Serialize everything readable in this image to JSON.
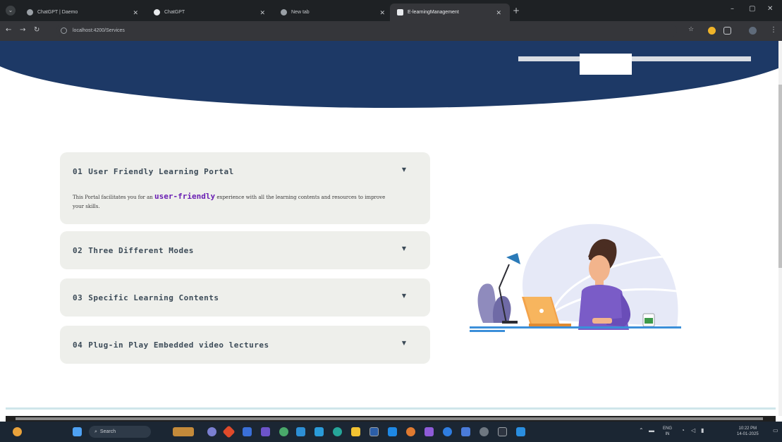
{
  "browser": {
    "tabs": [
      {
        "label": "ChatGPT | Daemo"
      },
      {
        "label": "ChatGPT"
      },
      {
        "label": "New tab"
      },
      {
        "label": "E-learningManagement"
      }
    ],
    "new_tab": "+",
    "minimize": "–",
    "maximize": "▢",
    "close": "✕",
    "url": "localhost:4200/Services"
  },
  "features": [
    {
      "num": "01",
      "title": "User Friendly Learning Portal",
      "expanded": true,
      "body_pre": "This Portal facilitates you for an ",
      "body_highlight": "user-friendly",
      "body_post": " experience with all the learning contents and resources to improve your skills."
    },
    {
      "num": "02",
      "title": "Three Different Modes",
      "expanded": false
    },
    {
      "num": "03",
      "title": "Specific Learning Contents",
      "expanded": false
    },
    {
      "num": "04",
      "title": "Plug-in Play Embedded video lectures",
      "expanded": false
    }
  ],
  "taskbar": {
    "search_placeholder": "Search",
    "lang": "ENG",
    "lang_sub": "IN",
    "time": "10:22 PM",
    "date": "14-01-2025"
  },
  "colors": {
    "hero": "#1d3966",
    "accordion_bg": "#eeefeb",
    "highlight": "#6a1fb3",
    "taskbar": "#1b2633"
  }
}
